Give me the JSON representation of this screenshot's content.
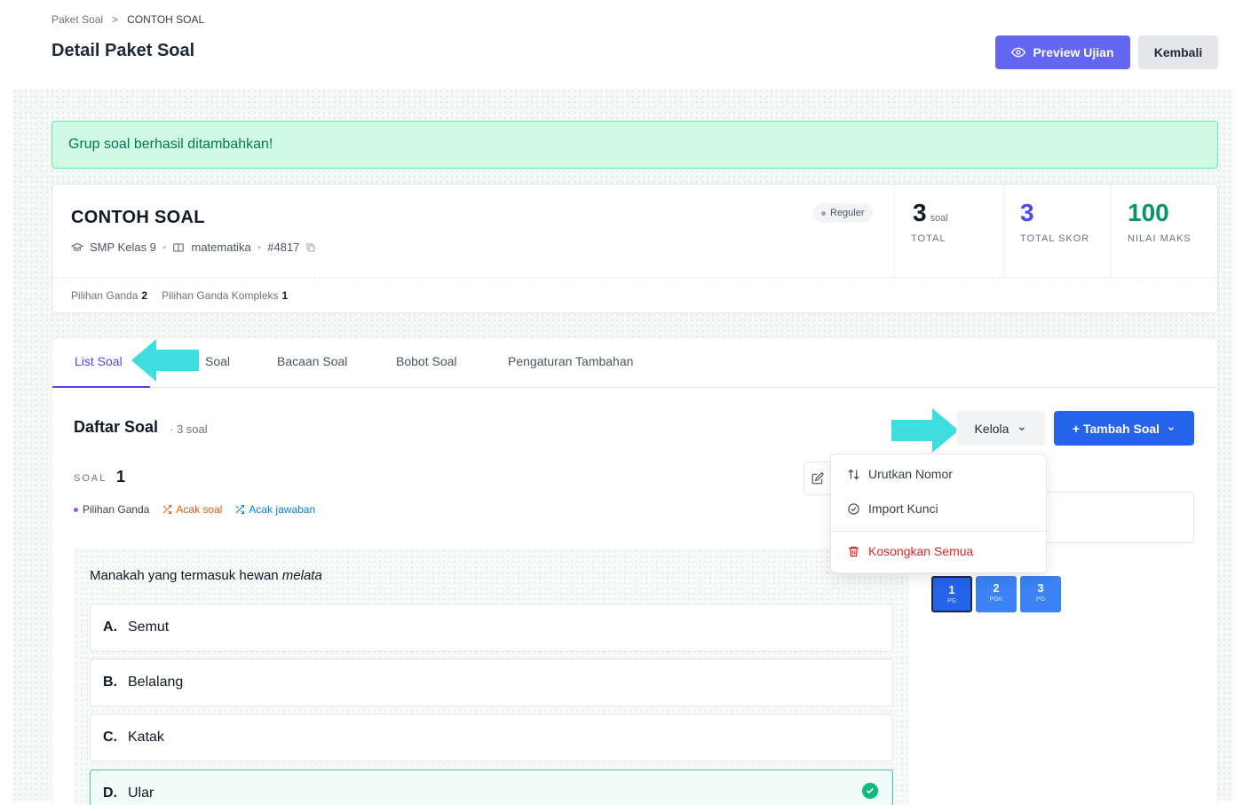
{
  "breadcrumb": {
    "parent": "Paket Soal",
    "separator": ">",
    "current": "CONTOH SOAL"
  },
  "header": {
    "title": "Detail Paket Soal",
    "preview_label": "Preview Ujian",
    "back_label": "Kembali"
  },
  "alert": {
    "message": "Grup soal berhasil ditambahkan!"
  },
  "paket": {
    "title": "CONTOH SOAL",
    "level": "SMP Kelas 9",
    "subject": "matematika",
    "code": "#4817",
    "badge": "Reguler",
    "stats": {
      "total_value": "3",
      "total_unit": "soal",
      "total_label": "TOTAL",
      "skor_value": "3",
      "skor_label": "TOTAL SKOR",
      "nilai_value": "100",
      "nilai_label": "NILAI MAKS"
    },
    "types": [
      {
        "label": "Pilihan Ganda",
        "count": "2"
      },
      {
        "label": "Pilihan Ganda Kompleks",
        "count": "1"
      }
    ]
  },
  "tabs": [
    "List Soal",
    "Soal",
    "Bacaan Soal",
    "Bobot Soal",
    "Pengaturan Tambahan"
  ],
  "list": {
    "title": "Daftar Soal",
    "count": "· 3 soal",
    "kelola_label": "Kelola",
    "tambah_label": "+ Tambah Soal"
  },
  "soal": {
    "label": "SOAL",
    "number": "1",
    "type": "Pilihan Ganda",
    "acak_soal": "Acak soal",
    "acak_jawaban": "Acak jawaban",
    "question_prefix": "Manakah yang termasuk hewan ",
    "question_emph": "melata",
    "options": [
      {
        "letter": "A.",
        "text": "Semut"
      },
      {
        "letter": "B.",
        "text": "Belalang"
      },
      {
        "letter": "C.",
        "text": "Katak"
      },
      {
        "letter": "D.",
        "text": "Ular"
      }
    ],
    "correct_option": "D"
  },
  "dropdown": {
    "urutkan": "Urutkan Nomor",
    "import": "Import Kunci",
    "kosongkan": "Kosongkan Semua"
  },
  "navigator": [
    {
      "num": "1",
      "kind": "PG"
    },
    {
      "num": "2",
      "kind": "PGK"
    },
    {
      "num": "3",
      "kind": "PG"
    }
  ],
  "colors": {
    "primary": "#6366f1",
    "blue": "#2563eb",
    "success": "#10b981",
    "danger": "#dc2626",
    "annotation": "#3fdde0"
  }
}
